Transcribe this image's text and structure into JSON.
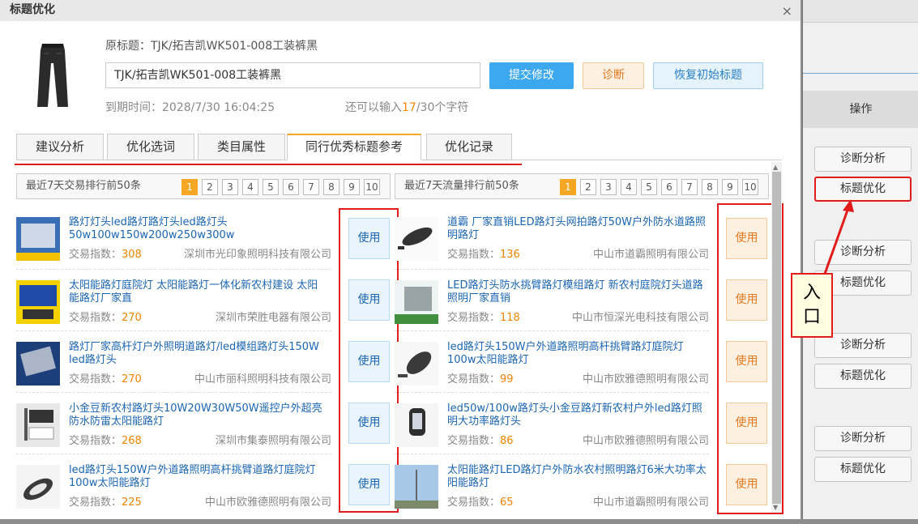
{
  "dialog": {
    "title": "标题优化",
    "close_label": "×",
    "original_title_text": "原标题：TJK/拓吉凯WK501-008工装裤黑",
    "title_input_value": "TJK/拓吉凯WK501-008工装裤黑",
    "submit_label": "提交修改",
    "diagnose_label": "诊断",
    "restore_label": "恢复初始标题",
    "expire_text": "到期时间：2028/7/30 16:04:25",
    "remain_prefix": "还可以输入",
    "remain_num": "17",
    "remain_suffix": "/30个字符"
  },
  "tabs": [
    {
      "label": "建议分析"
    },
    {
      "label": "优化选词"
    },
    {
      "label": "类目属性"
    },
    {
      "label": "同行优秀标题参考",
      "active": true
    },
    {
      "label": "优化记录"
    }
  ],
  "rank_left": {
    "label": "最近7天交易排行前50条"
  },
  "rank_right": {
    "label": "最近7天流量排行前50条"
  },
  "pages": [
    "1",
    "2",
    "3",
    "4",
    "5",
    "6",
    "7",
    "8",
    "9",
    "10"
  ],
  "current_page": "1",
  "use_label": "使用",
  "index_label": "交易指数：",
  "left_items": [
    {
      "name": "路灯灯头led路灯路灯头led路灯头50w100w150w200w250w300w",
      "index": "308",
      "company": "深圳市光印象照明科技有限公司"
    },
    {
      "name": "太阳能路灯庭院灯 太阳能路灯一体化新农村建设 太阳能路灯厂家直",
      "index": "270",
      "company": "深圳市荣胜电器有限公司"
    },
    {
      "name": "路灯厂家高杆灯户外照明道路灯/led模组路灯头150W led路灯头",
      "index": "270",
      "company": "中山市丽科照明科技有限公司"
    },
    {
      "name": "小金豆新农村路灯头10W20W30W50W遥控户外超亮防水防雷太阳能路灯",
      "index": "268",
      "company": "深圳市集泰照明有限公司"
    },
    {
      "name": "led路灯头150W户外道路照明高杆挑臂道路灯庭院灯100w太阳能路灯",
      "index": "225",
      "company": "中山市欧雅德照明有限公司"
    }
  ],
  "right_items": [
    {
      "name": "道霸 厂家直销LED路灯头网拍路灯50W户外防水道路照明路灯",
      "index": "136",
      "company": "中山市道霸照明有限公司"
    },
    {
      "name": "LED路灯头防水挑臂路灯模组路灯 新农村庭院灯头道路照明厂家直销",
      "index": "118",
      "company": "中山市恒深光电科技有限公司"
    },
    {
      "name": "led路灯头150W户外道路照明高杆挑臂路灯庭院灯100w太阳能路灯",
      "index": "99",
      "company": "中山市欧雅德照明有限公司"
    },
    {
      "name": "led50w/100w路灯头小金豆路灯新农村户外led路灯照明大功率路灯头",
      "index": "86",
      "company": "中山市欧雅德照明有限公司"
    },
    {
      "name": "太阳能路灯LED路灯户外防水农村照明路灯6米大功率太阳能路灯",
      "index": "65",
      "company": "中山市道霸照明有限公司"
    }
  ],
  "right_panel": {
    "header": "操作",
    "buttons": [
      "诊断分析",
      "标题优化",
      "诊断分析",
      "标题优化",
      "诊断分析",
      "标题优化",
      "诊断分析",
      "标题优化"
    ]
  },
  "callout": {
    "line1": "入",
    "line2": "口"
  },
  "colors": {
    "accent": "#f5a623",
    "blue": "#3ba8f0",
    "annotation_red": "#e21b1b"
  }
}
